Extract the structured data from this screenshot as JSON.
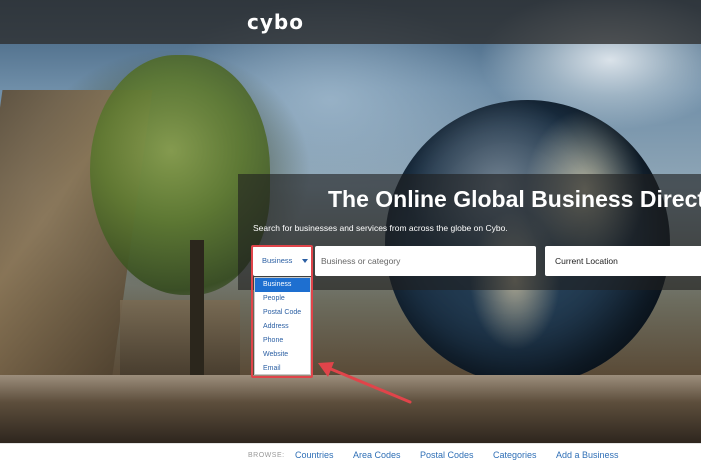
{
  "header": {
    "logo_text": "cybo"
  },
  "hero": {
    "headline": "The Online Global Business Direct",
    "subtitle": "Search for businesses and services from across the globe on Cybo."
  },
  "search": {
    "type_selected": "Business",
    "query_placeholder": "Business or category",
    "location_value": "Current Location",
    "type_options": [
      "Business",
      "People",
      "Postal Code",
      "Address",
      "Phone",
      "Website",
      "Email"
    ],
    "selected_index": 0
  },
  "browse": {
    "label": "BROWSE:",
    "links": [
      "Countries",
      "Area Codes",
      "Postal Codes",
      "Categories",
      "Add a Business"
    ]
  },
  "colors": {
    "accent": "#1e6fd0",
    "link": "#2f6fb6",
    "highlight": "#e0444a"
  }
}
